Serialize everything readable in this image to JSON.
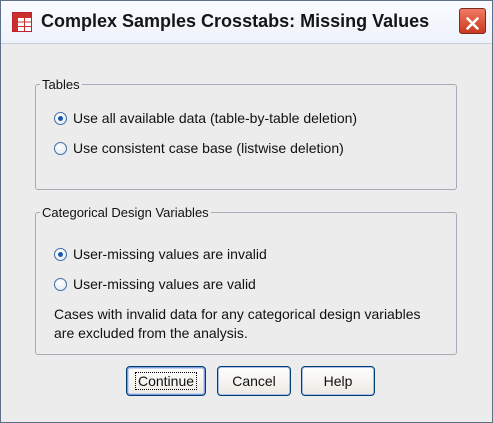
{
  "window": {
    "title": "Complex Samples Crosstabs: Missing Values",
    "icon": "crosstabs-table-icon",
    "close_icon": "close-icon"
  },
  "tables": {
    "legend": "Tables",
    "options": [
      {
        "label": "Use all available data (table-by-table deletion)",
        "selected": true
      },
      {
        "label": "Use consistent case base (listwise deletion)",
        "selected": false
      }
    ]
  },
  "categorical": {
    "legend": "Categorical Design Variables",
    "options": [
      {
        "label": "User-missing values are invalid",
        "selected": true
      },
      {
        "label": "User-missing values are valid",
        "selected": false
      }
    ],
    "note": "Cases with invalid data for any categorical design variables are excluded from the analysis."
  },
  "buttons": {
    "continue": "Continue",
    "cancel": "Cancel",
    "help": "Help"
  },
  "colors": {
    "close_button": "#d9472d",
    "radio_selected": "#1f57a8",
    "title_text": "#151515"
  }
}
